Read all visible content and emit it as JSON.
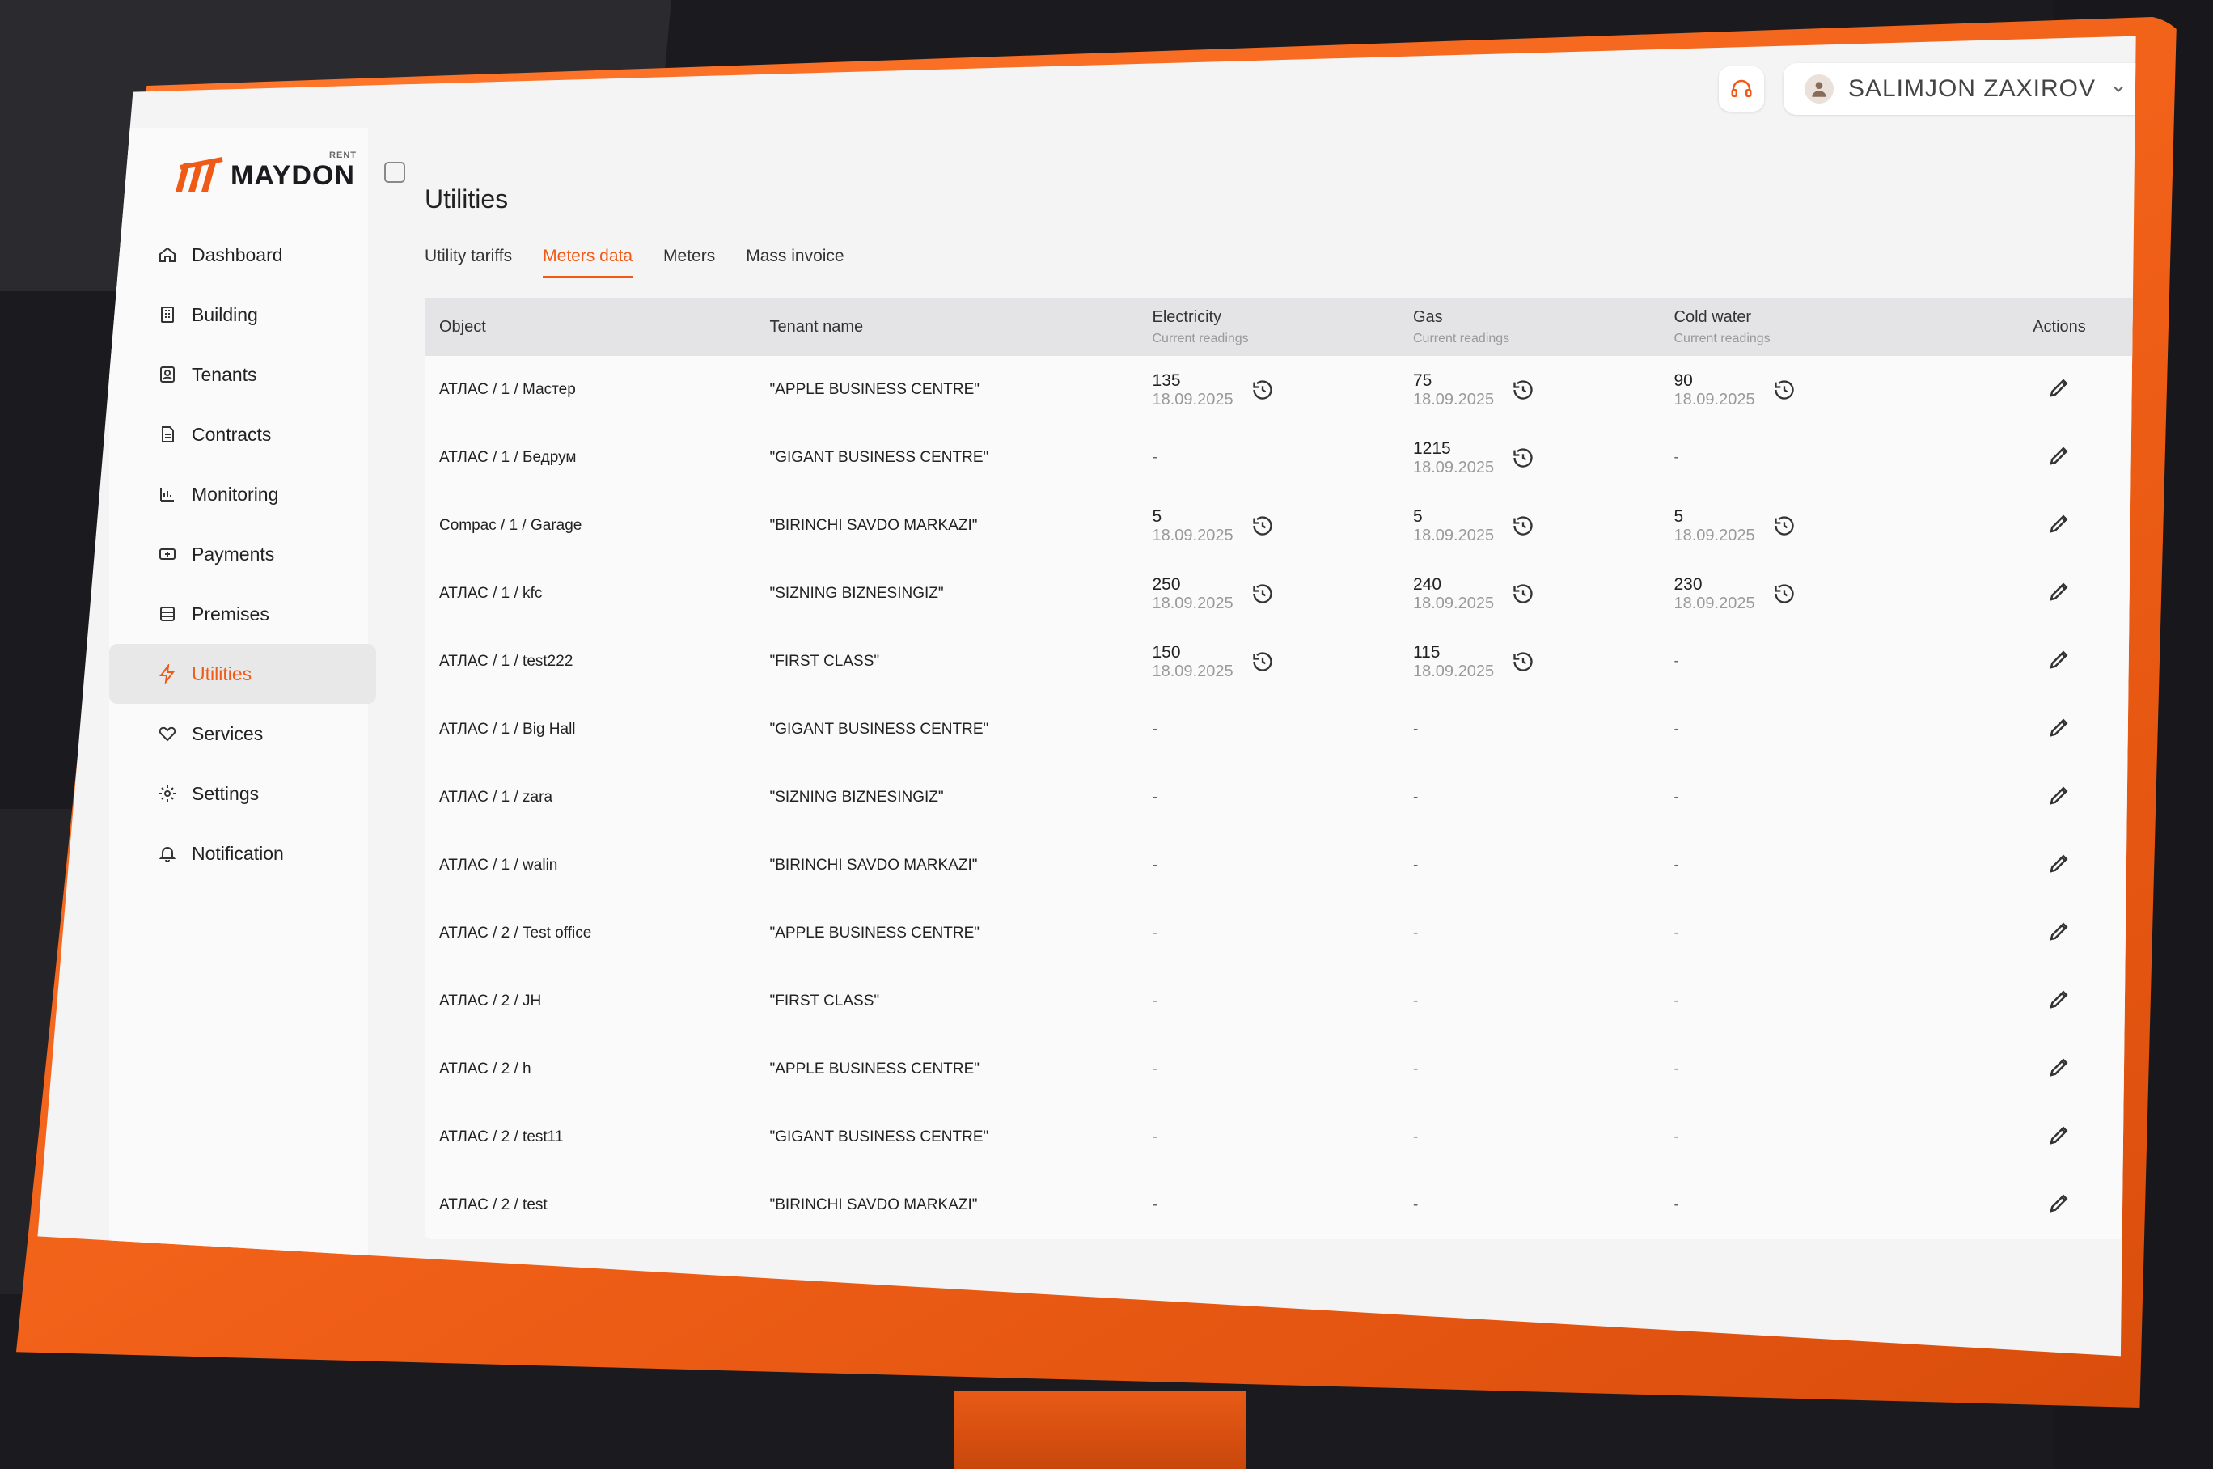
{
  "app": {
    "brand": "MAYDON",
    "brand_sub": "RENT",
    "accent": "#f05a16"
  },
  "topbar": {
    "support_icon": "headset-icon",
    "user_name": "SALIMJON ZAXIROV"
  },
  "sidebar": {
    "items": [
      {
        "label": "Dashboard",
        "icon": "home-icon"
      },
      {
        "label": "Building",
        "icon": "building-icon"
      },
      {
        "label": "Tenants",
        "icon": "tenant-icon"
      },
      {
        "label": "Contracts",
        "icon": "document-icon"
      },
      {
        "label": "Monitoring",
        "icon": "chart-icon"
      },
      {
        "label": "Payments",
        "icon": "payment-icon"
      },
      {
        "label": "Premises",
        "icon": "premises-icon"
      },
      {
        "label": "Utilities",
        "icon": "bolt-icon",
        "active": true
      },
      {
        "label": "Services",
        "icon": "services-icon"
      },
      {
        "label": "Settings",
        "icon": "gear-icon"
      },
      {
        "label": "Notification",
        "icon": "bell-icon"
      }
    ]
  },
  "main": {
    "title": "Utilities",
    "tabs": [
      {
        "label": "Utility tariffs"
      },
      {
        "label": "Meters data",
        "active": true
      },
      {
        "label": "Meters"
      },
      {
        "label": "Mass invoice"
      }
    ],
    "table": {
      "columns": {
        "object": "Object",
        "tenant": "Tenant name",
        "electricity": "Electricity",
        "gas": "Gas",
        "cold_water": "Cold water",
        "sub": "Current readings",
        "actions": "Actions"
      },
      "rows": [
        {
          "object": "АТЛАС / 1 / Мастер",
          "tenant": "\"APPLE BUSINESS CENTRE\"",
          "electricity": {
            "v": "135",
            "d": "18.09.2025"
          },
          "gas": {
            "v": "75",
            "d": "18.09.2025"
          },
          "cold_water": {
            "v": "90",
            "d": "18.09.2025"
          }
        },
        {
          "object": "АТЛАС / 1 / Бедрум",
          "tenant": "\"GIGANT BUSINESS CENTRE\"",
          "electricity": null,
          "gas": {
            "v": "1215",
            "d": "18.09.2025"
          },
          "cold_water": null
        },
        {
          "object": "Compac / 1 / Garage",
          "tenant": "\"BIRINCHI SAVDO MARKAZI\"",
          "electricity": {
            "v": "5",
            "d": "18.09.2025"
          },
          "gas": {
            "v": "5",
            "d": "18.09.2025"
          },
          "cold_water": {
            "v": "5",
            "d": "18.09.2025"
          }
        },
        {
          "object": "АТЛАС / 1 / kfc",
          "tenant": "\"SIZNING BIZNESINGIZ\"",
          "electricity": {
            "v": "250",
            "d": "18.09.2025"
          },
          "gas": {
            "v": "240",
            "d": "18.09.2025"
          },
          "cold_water": {
            "v": "230",
            "d": "18.09.2025"
          }
        },
        {
          "object": "АТЛАС / 1 / test222",
          "tenant": "\"FIRST CLASS\"",
          "electricity": {
            "v": "150",
            "d": "18.09.2025"
          },
          "gas": {
            "v": "115",
            "d": "18.09.2025"
          },
          "cold_water": null
        },
        {
          "object": "АТЛАС / 1 / Big Hall",
          "tenant": "\"GIGANT BUSINESS CENTRE\"",
          "electricity": null,
          "gas": null,
          "cold_water": null
        },
        {
          "object": "АТЛАС / 1 / zara",
          "tenant": "\"SIZNING BIZNESINGIZ\"",
          "electricity": null,
          "gas": null,
          "cold_water": null
        },
        {
          "object": "АТЛАС / 1 / walin",
          "tenant": "\"BIRINCHI SAVDO MARKAZI\"",
          "electricity": null,
          "gas": null,
          "cold_water": null
        },
        {
          "object": "АТЛАС / 2 / Test office",
          "tenant": "\"APPLE BUSINESS CENTRE\"",
          "electricity": null,
          "gas": null,
          "cold_water": null
        },
        {
          "object": "АТЛАС / 2 / JH",
          "tenant": "\"FIRST CLASS\"",
          "electricity": null,
          "gas": null,
          "cold_water": null
        },
        {
          "object": "АТЛАС / 2 / h",
          "tenant": "\"APPLE BUSINESS CENTRE\"",
          "electricity": null,
          "gas": null,
          "cold_water": null
        },
        {
          "object": "АТЛАС / 2 / test11",
          "tenant": "\"GIGANT BUSINESS CENTRE\"",
          "electricity": null,
          "gas": null,
          "cold_water": null
        },
        {
          "object": "АТЛАС / 2 / test",
          "tenant": "\"BIRINCHI SAVDO MARKAZI\"",
          "electricity": null,
          "gas": null,
          "cold_water": null
        }
      ],
      "empty": "-"
    }
  }
}
